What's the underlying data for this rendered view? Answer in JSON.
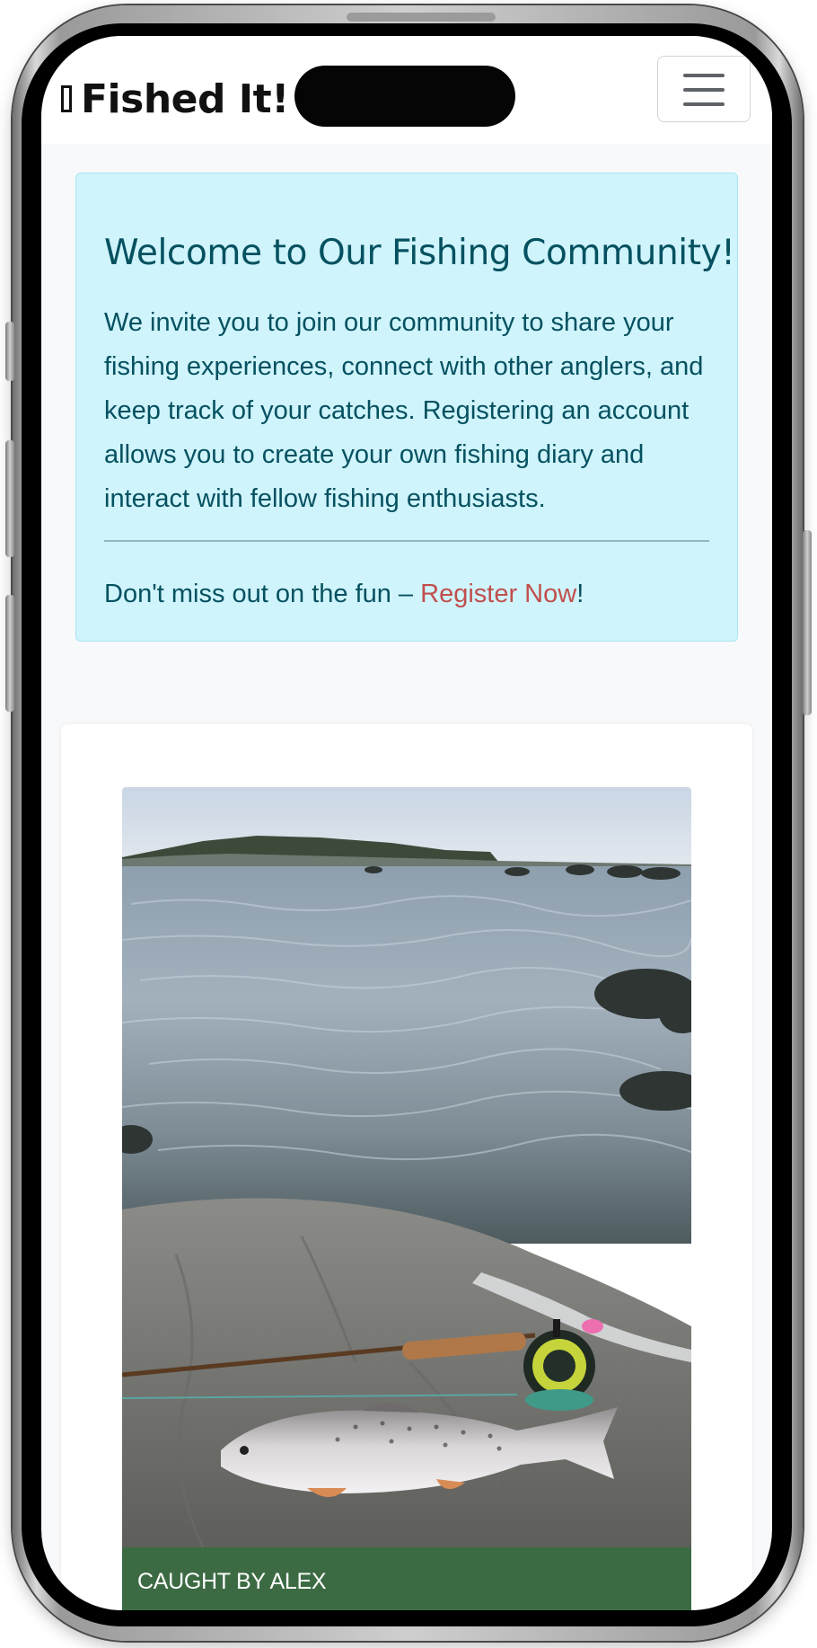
{
  "navbar": {
    "brand_icon": "fish-icon",
    "brand_text": "Fished It!",
    "menu_icon": "hamburger-menu-icon"
  },
  "welcome": {
    "heading": "Welcome to Our Fishing Community!",
    "body": "We invite you to join our community to share your fishing experiences, connect with other anglers, and keep track of your catches. Registering an account allows you to create your own fishing diary and interact with fellow fishing enthusiasts.",
    "footer_prefix": "Don't miss out on the fun – ",
    "register_link": "Register Now",
    "footer_suffix": "!"
  },
  "post": {
    "caption": "CAUGHT BY ALEX"
  },
  "colors": {
    "alert_bg": "#cff4fc",
    "alert_text": "#055160",
    "link": "#c0504d",
    "caption_bg": "#3c6b43"
  }
}
